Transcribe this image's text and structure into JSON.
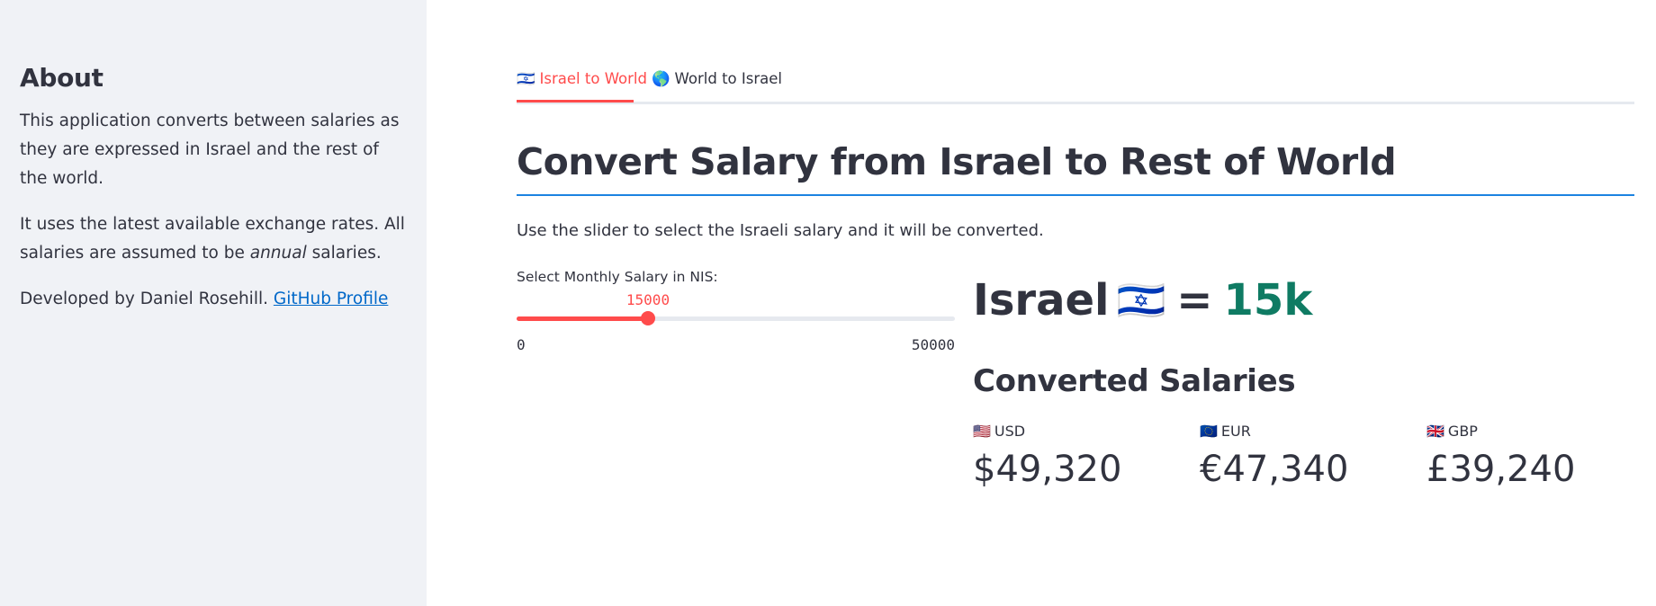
{
  "sidebar": {
    "heading": "About",
    "paragraph1": "This application converts between salaries as they are expressed in Israel and the rest of the world.",
    "paragraph2_before": "It uses the latest available exchange rates. All salaries are assumed to be ",
    "paragraph2_emphasis": "annual",
    "paragraph2_after": " salaries.",
    "paragraph3_before": "Developed by Daniel Rosehill. ",
    "github_link_text": "GitHub Profile"
  },
  "tabs": [
    {
      "flag": "🇮🇱",
      "label": "Israel to World",
      "active": true
    },
    {
      "flag": "🌎",
      "label": "World to Israel",
      "active": false
    }
  ],
  "main": {
    "title": "Convert Salary from Israel to Rest of World",
    "lede": "Use the slider to select the Israeli salary and it will be converted."
  },
  "slider": {
    "label": "Select Monthly Salary in NIS:",
    "value": 15000,
    "value_text": "15000",
    "min": 0,
    "max": 50000,
    "min_text": "0",
    "max_text": "50000",
    "accent_color": "#ff4b4b"
  },
  "result": {
    "country": "Israel",
    "flag": "🇮🇱",
    "equals": "=",
    "amount": "15k",
    "accent_color": "#0f7b63"
  },
  "converted": {
    "heading": "Converted Salaries",
    "metrics": [
      {
        "flag": "🇺🇸",
        "code": "USD",
        "value": "$49,320"
      },
      {
        "flag": "🇪🇺",
        "code": "EUR",
        "value": "€47,340"
      },
      {
        "flag": "🇬🇧",
        "code": "GBP",
        "value": "£39,240"
      }
    ]
  }
}
